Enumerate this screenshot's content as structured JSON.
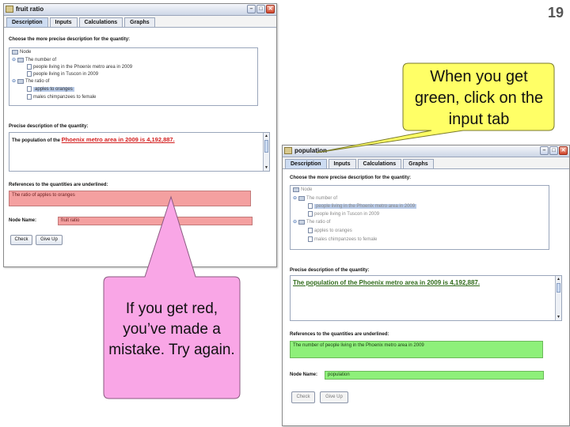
{
  "slide_number": "19",
  "left_window": {
    "title": "fruit ratio",
    "tabs": [
      "Description",
      "Inputs",
      "Calculations",
      "Graphs"
    ],
    "tree_label": "Choose the more precise description for the quantity:",
    "tree": {
      "root": "Node",
      "group1": "The number of",
      "item1": "people living in the Phoenix metro area in 2009",
      "item2": "people living in Tuscon in 2009",
      "group2": "The ratio of",
      "item3": "apples to oranges",
      "item4": "males chimpanzees to female"
    },
    "precise_label": "Precise description of the quantity:",
    "precise_prefix": "The population of the",
    "precise_link": "Phoenix metro area in 2009 is 4,192,887.",
    "refs_label": "References to the quantities are underlined:",
    "refs_value": "The ratio of apples to oranges",
    "node_name_label": "Node Name:",
    "node_name_value": "fruit ratio",
    "check_label": "Check",
    "giveup_label": "Give Up",
    "feedback_color": "#f4a0a0"
  },
  "right_window": {
    "title": "population",
    "tabs": [
      "Description",
      "Inputs",
      "Calculations",
      "Graphs"
    ],
    "tree_label": "Choose the more precise description for the quantity:",
    "tree": {
      "root": "Node",
      "group1": "The number of",
      "item1": "people living in the Phoenix metro area in 2009",
      "item2": "people living in Tuscon in 2009",
      "group2": "The ratio of",
      "item3": "apples to oranges",
      "item4": "males chimpanzees to female"
    },
    "precise_label": "Precise description of the quantity:",
    "precise_text": "The population of the Phoenix metro area in 2009 is 4,192,887.",
    "refs_label": "References to the quantities are underlined:",
    "refs_value": "The number of people living in the Phoenix metro area in 2009",
    "node_name_label": "Node Name:",
    "node_name_value": "population",
    "check_label": "Check",
    "giveup_label": "Give Up",
    "feedback_color": "#8ef07a"
  },
  "callouts": {
    "green_note": "When you get green, click on the input tab",
    "red_note": "If you get red, you’ve made a mistake. Try again.",
    "yellow_color": "#ffff66",
    "pink_color": "#f9a6e6"
  }
}
